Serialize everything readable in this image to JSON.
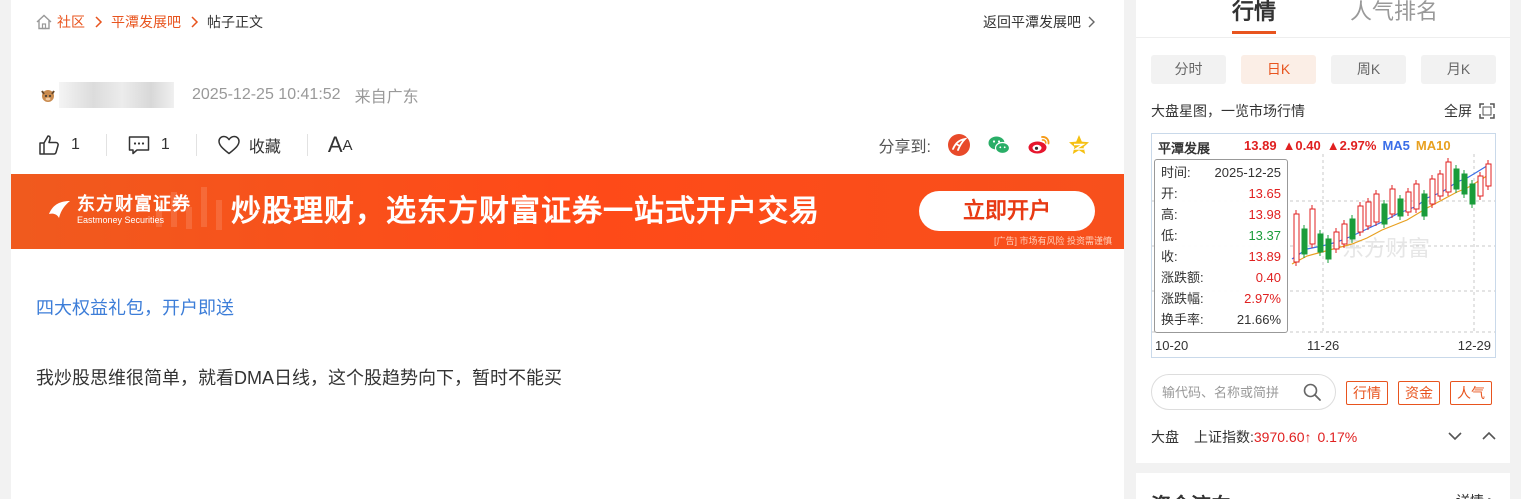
{
  "breadcrumb": {
    "items": [
      "社区",
      "平潭发展吧",
      "帖子正文"
    ],
    "back_label": "返回平潭发展吧"
  },
  "author": {
    "time": "2025-12-25 10:41:52",
    "location": "来自广东"
  },
  "actions": {
    "like_count": "1",
    "comment_count": "1",
    "favorite_label": "收藏",
    "font_big": "A",
    "font_small": "A",
    "share_label": "分享到:"
  },
  "banner": {
    "brand_cn": "东方财富证券",
    "brand_en": "Eastmoney Securities",
    "slogan": "炒股理财，选东方财富证券一站式开户交易",
    "cta": "立即开户",
    "disclaimer": "[广告] 市场有风险 投资需谨慎"
  },
  "post": {
    "promo_link": "四大权益礼包，开户即送",
    "body": "我炒股思维很简单，就看DMA日线，这个股趋势向下，暂时不能买"
  },
  "sidebar": {
    "tabs": [
      "行情",
      "人气排名"
    ],
    "ktabs": [
      "分时",
      "日K",
      "周K",
      "月K"
    ],
    "desc": "大盘星图，一览市场行情",
    "fullscreen": "全屏",
    "chart_head": {
      "name": "平潭发展",
      "price": "13.89",
      "change": "▲0.40",
      "pct": "▲2.97%",
      "ma5": "MA5",
      "ma10": "MA10"
    },
    "tooltip": [
      {
        "k": "时间:",
        "v": "2025-12-25"
      },
      {
        "k": "开:",
        "v": "13.65"
      },
      {
        "k": "高:",
        "v": "13.98"
      },
      {
        "k": "低:",
        "v": "13.37"
      },
      {
        "k": "收:",
        "v": "13.89"
      },
      {
        "k": "涨跌额:",
        "v": "0.40"
      },
      {
        "k": "涨跌幅:",
        "v": "2.97%"
      },
      {
        "k": "换手率:",
        "v": "21.66%"
      }
    ],
    "dates": [
      "10-20",
      "11-26",
      "12-29"
    ],
    "watermark": "东方财富",
    "search_placeholder": "输代码、名称或简拼",
    "pills": [
      "行情",
      "资金",
      "人气"
    ],
    "index": {
      "label": "大盘",
      "name": "上证指数:",
      "value": "3970.60↑",
      "change": "0.17%"
    },
    "section2_title": "资金流向",
    "section2_more": "详情 >"
  },
  "colors": {
    "accent": "#e8541e",
    "up": "#e02020",
    "down": "#1a9c3a",
    "link": "#3c7dd8"
  }
}
